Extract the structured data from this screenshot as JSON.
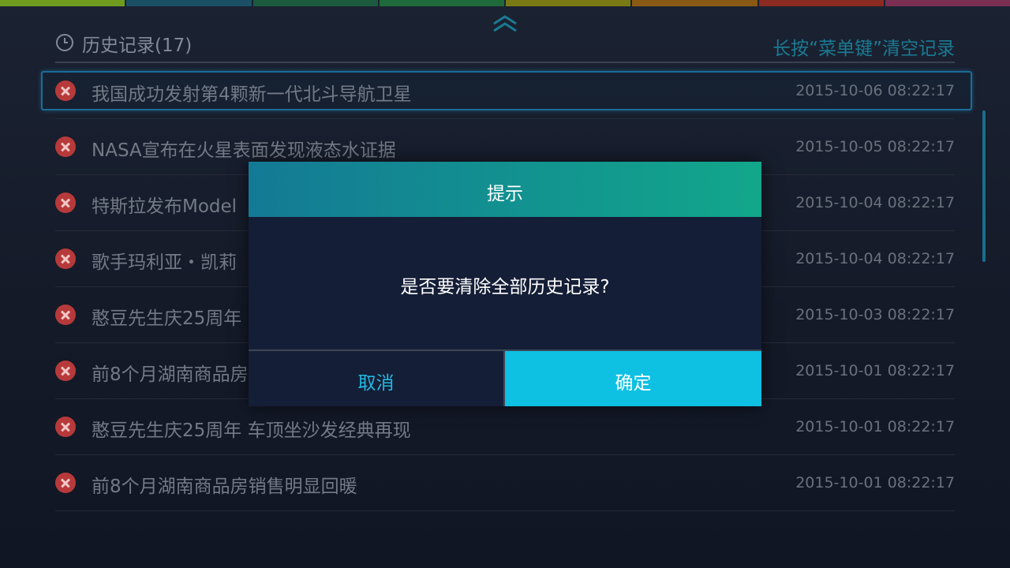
{
  "tab_colors": [
    "#6f9b1e",
    "#1b4f66",
    "#1c5a3e",
    "#1f6a3a",
    "#7a7a14",
    "#8a5a14",
    "#8a2a20",
    "#7a2e52"
  ],
  "header": {
    "title": "历史记录(17)",
    "clear_hint": "长按“菜单键”清空记录"
  },
  "history": [
    {
      "title": "我国成功发射第4颗新一代北斗导航卫星",
      "time": "2015-10-06 08:22:17"
    },
    {
      "title": "NASA宣布在火星表面发现液态水证据",
      "time": "2015-10-05 08:22:17"
    },
    {
      "title": "特斯拉发布Model",
      "time": "2015-10-04 08:22:17"
    },
    {
      "title": "歌手玛利亚・凯莉",
      "time": "2015-10-04 08:22:17"
    },
    {
      "title": "憨豆先生庆25周年",
      "time": "2015-10-03 08:22:17"
    },
    {
      "title": "前8个月湖南商品房",
      "time": "2015-10-01 08:22:17"
    },
    {
      "title": "憨豆先生庆25周年 车顶坐沙发经典再现",
      "time": "2015-10-01 08:22:17"
    },
    {
      "title": "前8个月湖南商品房销售明显回暖",
      "time": "2015-10-01 08:22:17"
    }
  ],
  "dialog": {
    "title": "提示",
    "message": "是否要清除全部历史记录?",
    "cancel_label": "取消",
    "confirm_label": "确定"
  },
  "colors": {
    "accent": "#0ec0e2",
    "dialog_header_start": "#137a95",
    "dialog_header_end": "#12a78b",
    "delete": "#b73a3a"
  }
}
